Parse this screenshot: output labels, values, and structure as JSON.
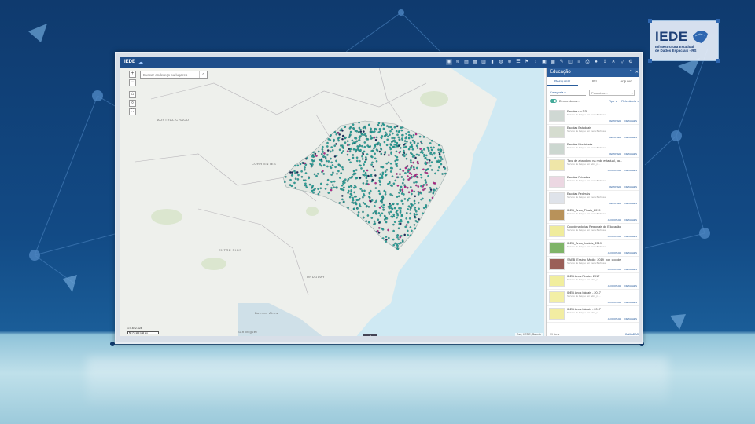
{
  "logo": {
    "title": "IEDE",
    "subtitle_lines": [
      "Infraestrutura Estadual",
      "de Dados Espaciais - RS"
    ],
    "map_icon": "rs-map-icon"
  },
  "app": {
    "brand": "IEDE",
    "brand_icon": "cloud-icon"
  },
  "toolbar_icons": [
    "eye-icon",
    "layers-icon",
    "book-icon",
    "grid-icon",
    "table-icon",
    "chart-icon",
    "globe-icon",
    "filter-icon",
    "list-icon",
    "pin-icon",
    "dots-icon",
    "building-icon",
    "city-icon",
    "pen-icon",
    "stack-icon",
    "rows-icon",
    "print-icon",
    "mic-icon",
    "share-icon",
    "close-icon",
    "funnel-icon",
    "gear-icon"
  ],
  "map": {
    "search_placeholder": "Buscar endereço ou lugares",
    "search_icon": "search-icon",
    "zoom_in": "+",
    "zoom_out": "−",
    "home_icon": "home-icon",
    "locate_icon": "locate-icon",
    "fullscreen_icon": "fullscreen-icon",
    "scale": "1:4.622.324",
    "scalebar": "50 75 100 150 km",
    "attribution": "Esri, HERE, Garmin",
    "handle_icon": "chevron-up-icon",
    "labels": [
      "AUSTRAL CHACO",
      "CORRIENTES",
      "ENTRE RIOS",
      "URUGUAY",
      "Buenos Aires",
      "San Miguel"
    ]
  },
  "panel": {
    "title": "Educação",
    "collapse_icon": "collapse-icon",
    "close_icon": "close-icon",
    "tabs": [
      "Pesquisar",
      "URL",
      "Arquivo"
    ],
    "category_label": "Categoria",
    "search_placeholder": "Pesquisar...",
    "toggle_label": "Dentro do ma...",
    "type_label": "Tipo",
    "relevance_label": "Relevância",
    "items": [
      {
        "title": "Escolas no RS",
        "desc": "Serviço de Feição por mera Barbosa",
        "primary": "REMOVER",
        "secondary": "DETALHES",
        "thumb": "#cfd8d3"
      },
      {
        "title": "Escolas Estaduais",
        "desc": "Serviço de Feição por mera Barbosa",
        "primary": "REMOVER",
        "secondary": "DETALHES",
        "thumb": "#d5dccf"
      },
      {
        "title": "Escolas Municipais",
        "desc": "Serviço de Feição por mera Barbosa",
        "primary": "REMOVER",
        "secondary": "DETALHES",
        "thumb": "#ccd7d0"
      },
      {
        "title": "Taxa de abandono na rede estadual, na...",
        "desc": "Serviço de Feição por adm_m...",
        "primary": "ADICIONAR",
        "secondary": "DETALHES",
        "thumb": "#efe6a8"
      },
      {
        "title": "Escolas Privadas",
        "desc": "Serviço de Feição por mera Barbosa",
        "primary": "REMOVER",
        "secondary": "DETALHES",
        "thumb": "#ecd7e2"
      },
      {
        "title": "Escolas Federais",
        "desc": "Serviço de Feição por mera Barbosa",
        "primary": "REMOVER",
        "secondary": "DETALHES",
        "thumb": "#dfe3ea"
      },
      {
        "title": "IDEB_Anos_Finais_2019",
        "desc": "Serviço de Feição por mera Barbosa",
        "primary": "ADICIONAR",
        "secondary": "DETALHES",
        "thumb": "#b8925a"
      },
      {
        "title": "Coordenadorias Regionais de Educação",
        "desc": "Serviço de Feição por mera Barbosa",
        "primary": "ADICIONAR",
        "secondary": "DETALHES",
        "thumb": "#f0ec9c"
      },
      {
        "title": "IDEB_Anos_Iniciais_2019",
        "desc": "Serviço de Feição por mera Barbosa",
        "primary": "ADICIONAR",
        "secondary": "DETALHES",
        "thumb": "#7fb468"
      },
      {
        "title": "SAEB_Ensino_Medio_2019_por_coorde",
        "desc": "Serviço de Feição por mera Barbosa",
        "primary": "ADICIONAR",
        "secondary": "DETALHES",
        "thumb": "#9a5f58"
      },
      {
        "title": "IDEB Anos Finais - 2017",
        "desc": "Serviço de Feição por adm_m...",
        "primary": "ADICIONAR",
        "secondary": "DETALHES",
        "thumb": "#f1ee9e"
      },
      {
        "title": "IDEB Anos Iniciais - 2017",
        "desc": "Serviço de Feição por adm_m...",
        "primary": "ADICIONAR",
        "secondary": "DETALHES",
        "thumb": "#f3efa6"
      },
      {
        "title": "IDEB Anos Iniciais - 2017",
        "desc": "Serviço de Feição por adm_m...",
        "primary": "ADICIONAR",
        "secondary": "DETALHES",
        "thumb": "#f2eda2"
      }
    ],
    "footer_count": "19 itens",
    "footer_button": "CAMADAS"
  },
  "colors": {
    "background": "#124a85",
    "app_header": "#1f4e8a",
    "panel_header": "#2a5d9c",
    "school_teal": "#2aa59a",
    "school_magenta": "#c0268a",
    "school_navy": "#1d2a5a"
  }
}
